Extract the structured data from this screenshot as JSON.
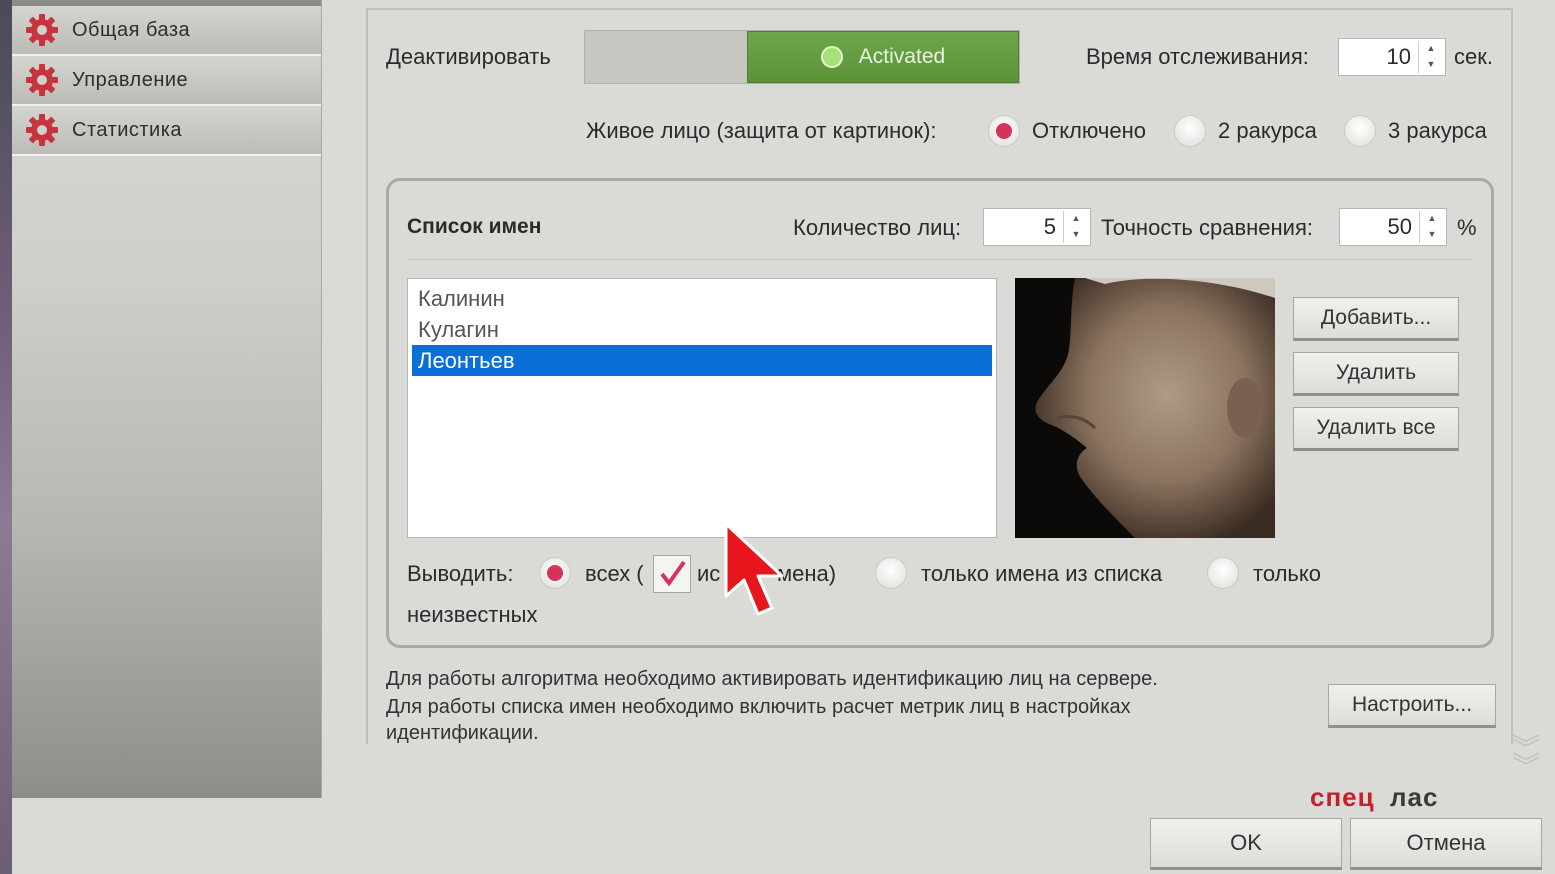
{
  "sidebar": {
    "items": [
      {
        "label": "Общая база",
        "icon": "gear-icon"
      },
      {
        "label": "Управление",
        "icon": "gear-icon"
      },
      {
        "label": "Статистика",
        "icon": "gear-icon"
      }
    ]
  },
  "activation": {
    "deactivate_label": "Деактивировать",
    "toggle_state": "Activated",
    "accent": "#5a9339"
  },
  "tracking": {
    "label": "Время отслеживания:",
    "value": "10",
    "unit": "сек."
  },
  "liveness": {
    "label": "Живое лицо (защита от картинок):",
    "options": [
      "Отключено",
      "2 ракурса",
      "3 ракурса"
    ],
    "selected": "Отключено"
  },
  "names_group": {
    "title": "Список имен",
    "face_count_label": "Количество лиц:",
    "face_count_value": "5",
    "accuracy_label": "Точность сравнения:",
    "accuracy_value": "50",
    "accuracy_unit": "%",
    "names": [
      "Калинин",
      "Кулагин",
      "Леонтьев"
    ],
    "selected_name": "Леонтьев",
    "buttons": {
      "add": "Добавить...",
      "delete": "Удалить",
      "delete_all": "Удалить все"
    },
    "output": {
      "label": "Выводить:",
      "opt_all": "всех (",
      "opt_all_part1": "ис",
      "opt_all_part2": "мена)",
      "opt_list": "только имена из списка",
      "opt_unknown": "только",
      "opt_unknown_wrap": "неизвестных",
      "selected": "всех",
      "checkbox_checked": true
    }
  },
  "notes": {
    "line1": "Для работы алгоритма необходимо активировать идентификацию лиц на сервере.",
    "line2": "Для работы списка имен необходимо включить расчет метрик лиц в настройках",
    "line3": "идентификации.",
    "configure_button": "Настроить..."
  },
  "footer": {
    "ok": "OK",
    "cancel": "Отмена",
    "logo_text": "спецлас",
    "logo_color": "#c8202a"
  }
}
